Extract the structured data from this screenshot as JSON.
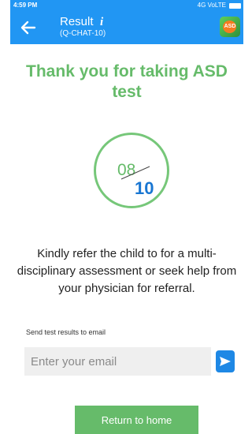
{
  "status_bar": {
    "time": "4:59 PM",
    "network": "4G VoLTE"
  },
  "app_bar": {
    "title": "Result",
    "info_icon": "i",
    "subtitle": "(Q-CHAT-10)",
    "back_icon": "arrow-left-icon",
    "logo_text": "ASD"
  },
  "headline": "Thank you for taking ASD test",
  "score": {
    "value": "08",
    "total": "10"
  },
  "message": "Kindly refer the child to for a multi-disciplinary assessment or seek help from your physician for referral.",
  "email": {
    "label": "Send test results to email",
    "placeholder": "Enter your email",
    "value": "",
    "send_icon": "send-icon"
  },
  "return_button": {
    "label": "Return to home"
  },
  "colors": {
    "primary_blue": "#2196f3",
    "accent_green": "#66bb6a",
    "score_total_blue": "#1976d2"
  }
}
